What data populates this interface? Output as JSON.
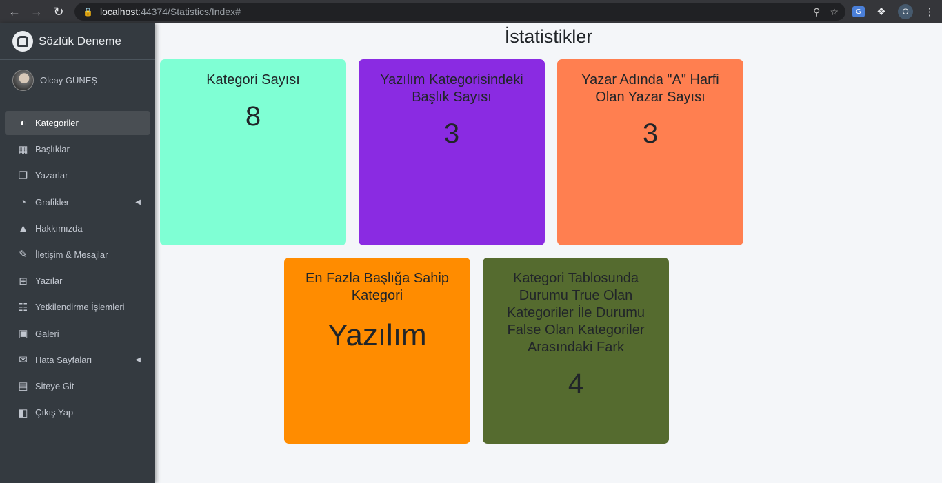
{
  "browser": {
    "url_host": "localhost",
    "url_rest": ":44374/Statistics/Index#",
    "profile_initial": "O",
    "translate_label": "G"
  },
  "sidebar": {
    "brand": "Sözlük Deneme",
    "user": "Olcay GÜNEŞ",
    "items": [
      {
        "label": "Kategoriler",
        "icon": "dashboard-icon"
      },
      {
        "label": "Başlıklar",
        "icon": "grid-icon"
      },
      {
        "label": "Yazarlar",
        "icon": "copy-icon"
      },
      {
        "label": "Grafikler",
        "icon": "pie-chart-icon"
      },
      {
        "label": "Hakkımızda",
        "icon": "tree-icon"
      },
      {
        "label": "İletişim & Mesajlar",
        "icon": "edit-icon"
      },
      {
        "label": "Yazılar",
        "icon": "table-icon"
      },
      {
        "label": "Yetkilendirme İşlemleri",
        "icon": "calendar-icon"
      },
      {
        "label": "Galeri",
        "icon": "image-icon"
      },
      {
        "label": "Hata Sayfaları",
        "icon": "envelope-icon"
      },
      {
        "label": "Siteye Git",
        "icon": "book-icon"
      },
      {
        "label": "Çıkış Yap",
        "icon": "door-icon"
      }
    ]
  },
  "main": {
    "title": "İstatistikler",
    "cards": [
      {
        "title": "Kategori Sayısı",
        "value": "8",
        "color": "#7fffd4"
      },
      {
        "title": "Yazılım Kategorisindeki Başlık Sayısı",
        "value": "3",
        "color": "#8a2be2"
      },
      {
        "title": "Yazar Adında \"A\" Harfi Olan Yazar Sayısı",
        "value": "3",
        "color": "#ff7f50"
      },
      {
        "title": "En Fazla Başlığa Sahip Kategori",
        "value": "Yazılım",
        "color": "#ff8c00"
      },
      {
        "title": "Kategori Tablosunda Durumu True Olan Kategoriler İle Durumu False Olan Kategoriler Arasındaki Fark",
        "value": "4",
        "color": "#556b2f"
      }
    ]
  }
}
